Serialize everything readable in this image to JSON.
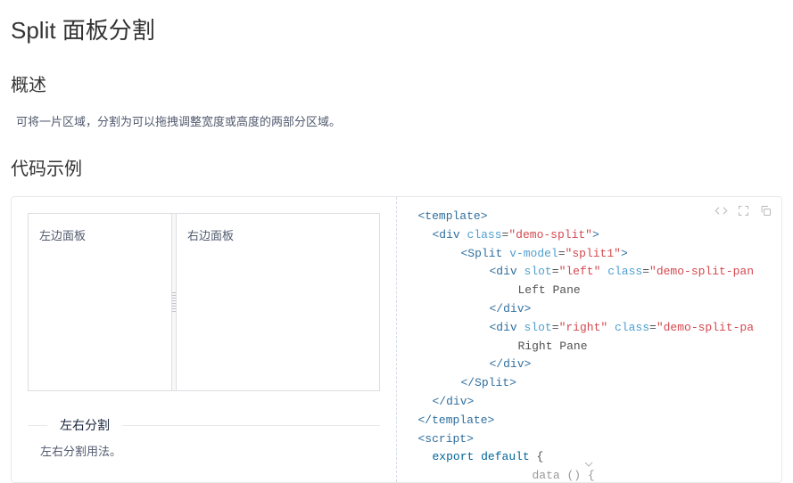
{
  "page": {
    "title": "Split 面板分割",
    "overview_heading": "概述",
    "overview_text": "可将一片区域，分割为可以拖拽调整宽度或高度的两部分区域。",
    "examples_heading": "代码示例"
  },
  "demo": {
    "left_label": "左边面板",
    "right_label": "右边面板",
    "caption_title": "左右分割",
    "caption_desc": "左右分割用法。"
  },
  "code": {
    "lines": [
      {
        "ind": 0,
        "html": "<span class='tok-tag'>&lt;template&gt;</span>"
      },
      {
        "ind": 1,
        "html": "<span class='tok-tag'>&lt;div</span> <span class='tok-attr'>class</span>=<span class='tok-str'>\"demo-split\"</span><span class='tok-tag'>&gt;</span>"
      },
      {
        "ind": 2,
        "html": "<span class='tok-tag'>&lt;Split</span> <span class='tok-attr'>v-model</span>=<span class='tok-str'>\"split1\"</span><span class='tok-tag'>&gt;</span>"
      },
      {
        "ind": 3,
        "html": "<span class='tok-tag'>&lt;div</span> <span class='tok-attr'>slot</span>=<span class='tok-str'>\"left\"</span> <span class='tok-attr'>class</span>=<span class='tok-str'>\"demo-split-pan</span>"
      },
      {
        "ind": 4,
        "html": "Left Pane"
      },
      {
        "ind": 3,
        "html": "<span class='tok-tag'>&lt;/div&gt;</span>"
      },
      {
        "ind": 3,
        "html": "<span class='tok-tag'>&lt;div</span> <span class='tok-attr'>slot</span>=<span class='tok-str'>\"right\"</span> <span class='tok-attr'>class</span>=<span class='tok-str'>\"demo-split-pa</span>"
      },
      {
        "ind": 4,
        "html": "Right Pane"
      },
      {
        "ind": 3,
        "html": "<span class='tok-tag'>&lt;/div&gt;</span>"
      },
      {
        "ind": 2,
        "html": "<span class='tok-tag'>&lt;/Split&gt;</span>"
      },
      {
        "ind": 1,
        "html": "<span class='tok-tag'>&lt;/div&gt;</span>"
      },
      {
        "ind": 0,
        "html": "<span class='tok-tag'>&lt;/template&gt;</span>"
      },
      {
        "ind": 0,
        "html": "<span class='tok-tag'>&lt;script&gt;</span>"
      },
      {
        "ind": 1,
        "html": "<span class='tok-kw'>export</span> <span class='tok-kw'>default</span> {"
      },
      {
        "ind": 5,
        "html": "<span class='tok-fn'>data () {</span>"
      }
    ]
  },
  "icons": {
    "code": "code-icon",
    "fullscreen": "fullscreen-icon",
    "copy": "copy-icon",
    "expand": "chevron-down-icon"
  }
}
